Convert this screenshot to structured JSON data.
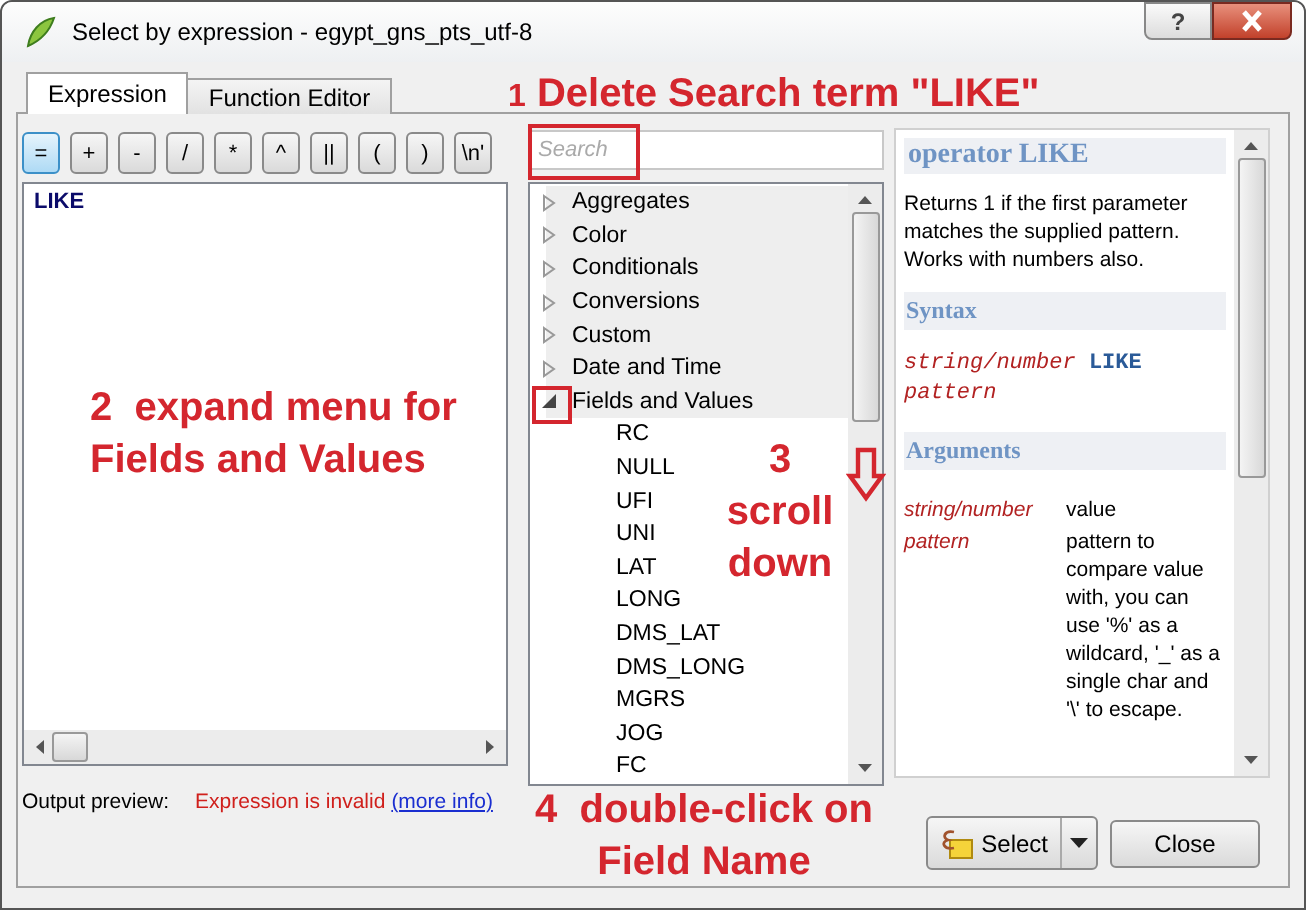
{
  "window": {
    "title": "Select by expression - egypt_gns_pts_utf-8",
    "help_button": "?"
  },
  "tabs": [
    {
      "label": "Expression",
      "selected": true
    },
    {
      "label": "Function Editor",
      "selected": false
    }
  ],
  "operator_buttons": [
    {
      "label": "=",
      "selected": true
    },
    {
      "label": "+",
      "selected": false
    },
    {
      "label": "-",
      "selected": false
    },
    {
      "label": "/",
      "selected": false
    },
    {
      "label": "*",
      "selected": false
    },
    {
      "label": "^",
      "selected": false
    },
    {
      "label": "||",
      "selected": false
    },
    {
      "label": "(",
      "selected": false
    },
    {
      "label": ")",
      "selected": false
    },
    {
      "label": "\\n'",
      "selected": false
    }
  ],
  "expression": "LIKE",
  "output_preview": {
    "label": "Output preview:",
    "message": "Expression is invalid",
    "link": "(more info)"
  },
  "search": {
    "placeholder": "Search"
  },
  "tree": [
    {
      "label": "Aggregates",
      "expanded": false
    },
    {
      "label": "Color",
      "expanded": false
    },
    {
      "label": "Conditionals",
      "expanded": false
    },
    {
      "label": "Conversions",
      "expanded": false
    },
    {
      "label": "Custom",
      "expanded": false
    },
    {
      "label": "Date and Time",
      "expanded": false
    },
    {
      "label": "Fields and Values",
      "expanded": true,
      "children": [
        {
          "label": "RC"
        },
        {
          "label": "NULL"
        },
        {
          "label": "UFI"
        },
        {
          "label": "UNI"
        },
        {
          "label": "LAT"
        },
        {
          "label": "LONG"
        },
        {
          "label": "DMS_LAT"
        },
        {
          "label": "DMS_LONG"
        },
        {
          "label": "MGRS"
        },
        {
          "label": "JOG"
        },
        {
          "label": "FC"
        }
      ]
    }
  ],
  "help": {
    "title": "operator LIKE",
    "description": "Returns 1 if the first parameter matches the supplied pattern. Works with numbers also.",
    "syntax_heading": "Syntax",
    "syntax": [
      {
        "kind": "arg",
        "text": "string/number"
      },
      {
        "kind": "keyword",
        "text": "LIKE"
      },
      {
        "kind": "arg",
        "text": "pattern"
      }
    ],
    "arguments_heading": "Arguments",
    "arguments": [
      {
        "name": "string/number",
        "description": "value"
      },
      {
        "name": "pattern",
        "description": "pattern to compare value with, you can use '%' as a wildcard, '_' as a single char and '\\' to escape."
      }
    ]
  },
  "buttons": {
    "select": "Select",
    "close": "Close"
  },
  "annotations": [
    {
      "number": "1",
      "text": "Delete Search term \"LIKE\""
    },
    {
      "number": "2",
      "text": "expand menu for Fields and Values"
    },
    {
      "number": "3",
      "text": "scroll down"
    },
    {
      "number": "4",
      "text": "double-click on Field Name"
    }
  ]
}
